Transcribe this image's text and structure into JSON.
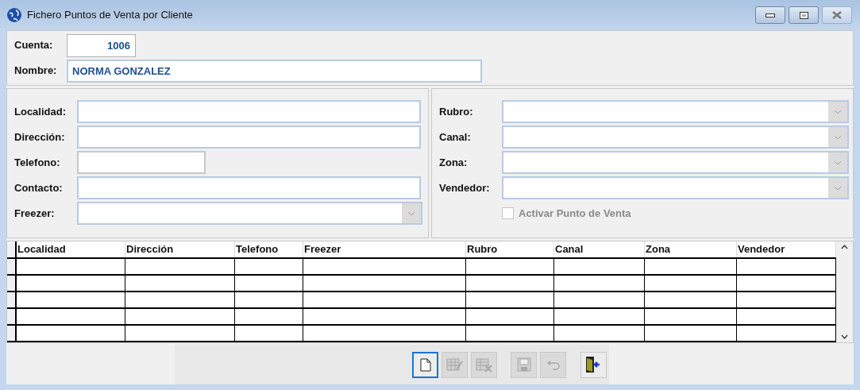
{
  "window": {
    "title": "Fichero Puntos de Venta por Cliente"
  },
  "header": [
    {
      "label": "Cuenta:",
      "value": "1006",
      "kind": "number"
    },
    {
      "label": "Nombre:",
      "value": "NORMA GONZALEZ",
      "kind": "text"
    }
  ],
  "left_fields": [
    {
      "label": "Localidad:",
      "kind": "text"
    },
    {
      "label": "Dirección:",
      "kind": "text"
    },
    {
      "label": "Telefono:",
      "kind": "short"
    },
    {
      "label": "Contacto:",
      "kind": "text"
    },
    {
      "label": "Freezer:",
      "kind": "combo"
    }
  ],
  "right_fields": [
    {
      "label": "Rubro:",
      "kind": "combo"
    },
    {
      "label": "Canal:",
      "kind": "combo"
    },
    {
      "label": "Zona:",
      "kind": "combo"
    },
    {
      "label": "Vendedor:",
      "kind": "combo"
    }
  ],
  "activate": {
    "label": "Activar Punto de Venta",
    "checked": false,
    "disabled": true
  },
  "table": {
    "columns": [
      "Localidad",
      "Dirección",
      "Telefono",
      "Freezer",
      "Rubro",
      "Canal",
      "Zona",
      "Vendedor"
    ]
  },
  "toolbar": [
    {
      "kind": "new",
      "disabled": false,
      "focused": true
    },
    {
      "kind": "edit",
      "disabled": true,
      "focused": false
    },
    {
      "kind": "delete",
      "disabled": true,
      "focused": false
    },
    {
      "kind": "save",
      "disabled": true,
      "focused": false
    },
    {
      "kind": "undo",
      "disabled": true,
      "focused": false
    },
    {
      "kind": "exit",
      "disabled": false,
      "focused": false
    }
  ]
}
